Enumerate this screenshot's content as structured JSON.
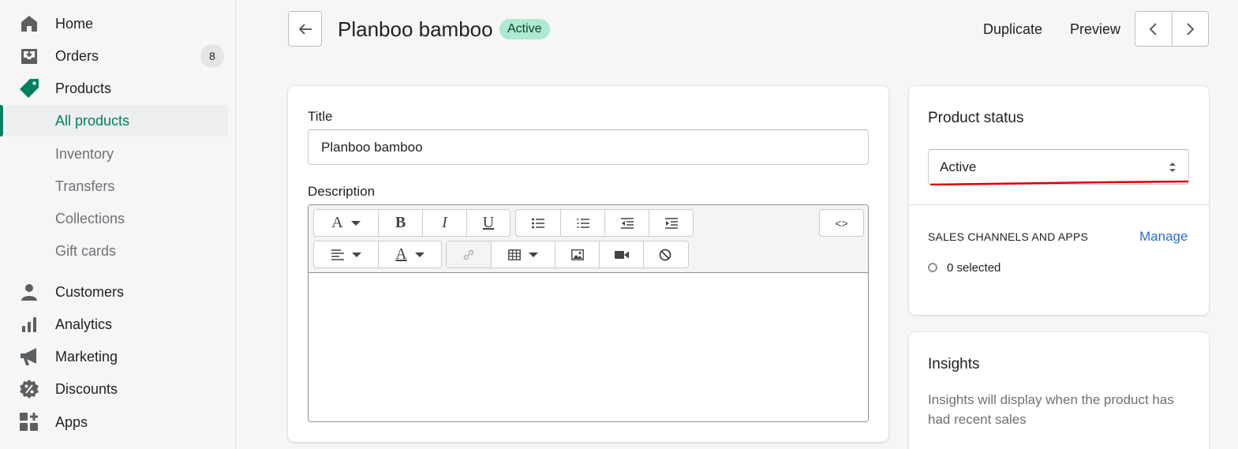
{
  "sidebar": {
    "items": [
      {
        "label": "Home",
        "icon": "home-icon"
      },
      {
        "label": "Orders",
        "icon": "orders-icon",
        "badge": "8"
      },
      {
        "label": "Products",
        "icon": "tag-icon"
      },
      {
        "label": "All products",
        "selected": true
      },
      {
        "label": "Inventory"
      },
      {
        "label": "Transfers"
      },
      {
        "label": "Collections"
      },
      {
        "label": "Gift cards"
      },
      {
        "label": "Customers",
        "icon": "person-icon"
      },
      {
        "label": "Analytics",
        "icon": "bar-chart-icon"
      },
      {
        "label": "Marketing",
        "icon": "megaphone-icon"
      },
      {
        "label": "Discounts",
        "icon": "discount-icon"
      },
      {
        "label": "Apps",
        "icon": "apps-icon"
      }
    ]
  },
  "header": {
    "title": "Planboo bamboo",
    "status": "Active",
    "duplicate": "Duplicate",
    "preview": "Preview"
  },
  "product": {
    "title_label": "Title",
    "title_value": "Planboo bamboo",
    "description_label": "Description",
    "toolbar": {
      "font": "A",
      "bold": "B",
      "italic": "I",
      "underline": "U",
      "text_color": "A",
      "code": "<>"
    }
  },
  "status_card": {
    "title": "Product status",
    "selected": "Active",
    "section_heading": "SALES CHANNELS AND APPS",
    "manage": "Manage",
    "selected_count": "0 selected"
  },
  "insights": {
    "title": "Insights",
    "body": "Insights will display when the product has had recent sales"
  },
  "colors": {
    "accent": "#008060",
    "status_bg": "#aee9d1",
    "link": "#2c6ecb",
    "annotation": "#e00000"
  }
}
